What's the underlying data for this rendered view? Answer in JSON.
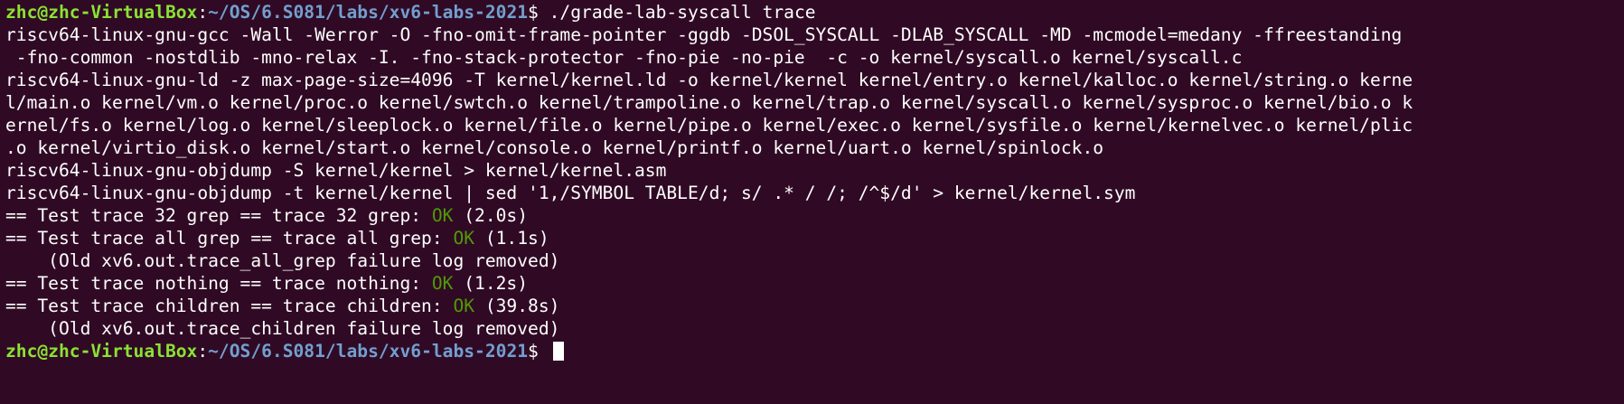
{
  "prompt": {
    "user_host": "zhc@zhc-VirtualBox",
    "colon": ":",
    "cwd": "~/OS/6.S081/labs/xv6-labs-2021",
    "symbol": "$ "
  },
  "command": "./grade-lab-syscall trace",
  "output": [
    "riscv64-linux-gnu-gcc -Wall -Werror -O -fno-omit-frame-pointer -ggdb -DSOL_SYSCALL -DLAB_SYSCALL -MD -mcmodel=medany -ffreestanding",
    " -fno-common -nostdlib -mno-relax -I. -fno-stack-protector -fno-pie -no-pie  -c -o kernel/syscall.o kernel/syscall.c",
    "riscv64-linux-gnu-ld -z max-page-size=4096 -T kernel/kernel.ld -o kernel/kernel kernel/entry.o kernel/kalloc.o kernel/string.o kerne",
    "l/main.o kernel/vm.o kernel/proc.o kernel/swtch.o kernel/trampoline.o kernel/trap.o kernel/syscall.o kernel/sysproc.o kernel/bio.o k",
    "ernel/fs.o kernel/log.o kernel/sleeplock.o kernel/file.o kernel/pipe.o kernel/exec.o kernel/sysfile.o kernel/kernelvec.o kernel/plic",
    ".o kernel/virtio_disk.o kernel/start.o kernel/console.o kernel/printf.o kernel/uart.o kernel/spinlock.o",
    "riscv64-linux-gnu-objdump -S kernel/kernel > kernel/kernel.asm",
    "riscv64-linux-gnu-objdump -t kernel/kernel | sed '1,/SYMBOL TABLE/d; s/ .* / /; /^$/d' > kernel/kernel.sym"
  ],
  "tests": [
    {
      "prefix": "== Test trace 32 grep == trace 32 grep: ",
      "status": "OK",
      "time": " (2.0s)",
      "note": ""
    },
    {
      "prefix": "== Test trace all grep == trace all grep: ",
      "status": "OK",
      "time": " (1.1s)",
      "note": "    (Old xv6.out.trace_all_grep failure log removed)"
    },
    {
      "prefix": "== Test trace nothing == trace nothing: ",
      "status": "OK",
      "time": " (1.2s)",
      "note": ""
    },
    {
      "prefix": "== Test trace children == trace children: ",
      "status": "OK",
      "time": " (39.8s)",
      "note": "    (Old xv6.out.trace_children failure log removed)"
    }
  ],
  "colors": {
    "background": "#300a24",
    "text": "#ffffff",
    "user_host": "#8ae234",
    "path": "#729fcf",
    "ok": "#4e9a06"
  }
}
